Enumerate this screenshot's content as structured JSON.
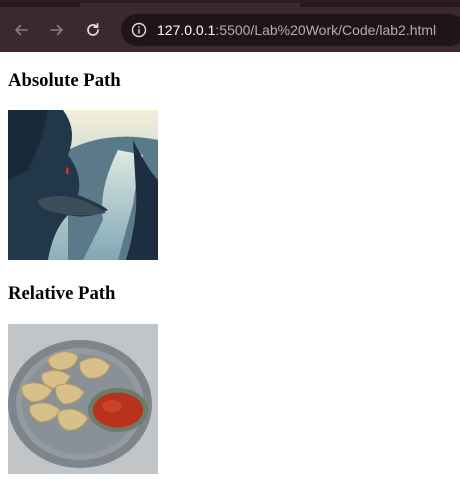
{
  "browser": {
    "url_host": "127.0.0.1",
    "url_path": ":5500/Lab%20Work/Code/lab2.html",
    "icons": {
      "back": "arrow-left-icon",
      "forward": "arrow-right-icon",
      "reload": "reload-icon",
      "site_info": "site-info-icon"
    }
  },
  "page": {
    "absolute_heading": "Absolute Path",
    "relative_heading": "Relative Path"
  },
  "colors": {
    "toolbar": "#3a2a30",
    "omnibox": "#1f1418"
  }
}
